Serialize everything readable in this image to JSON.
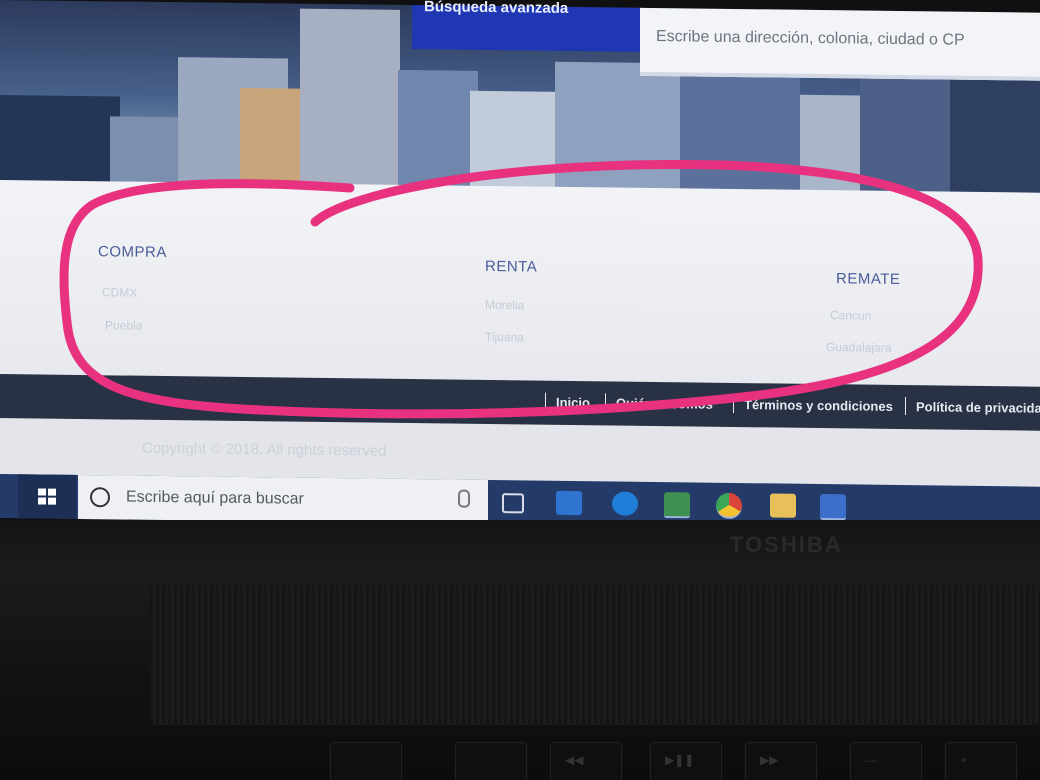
{
  "search": {
    "advanced_label": "Búsqueda avanzada",
    "placeholder": "Escribe una dirección, colonia, ciudad o CP"
  },
  "footer": {
    "columns": [
      {
        "title": "COMPRA",
        "links": [
          "CDMX",
          "Puebla"
        ]
      },
      {
        "title": "RENTA",
        "links": [
          "Morelia",
          "Tijuana"
        ]
      },
      {
        "title": "REMATE",
        "links": [
          "Cancun",
          "Guadalajara"
        ]
      }
    ]
  },
  "nav": {
    "items": [
      "Inicio",
      "Quiénes somos",
      "Términos y condiciones",
      "Política de privacidad"
    ]
  },
  "copyright": "Copyright © 2018. All rights reserved",
  "taskbar": {
    "search_placeholder": "Escribe aquí para buscar",
    "icons": [
      "windows-icon",
      "task-view-icon",
      "outlook-icon",
      "edge-icon",
      "excel-icon",
      "chrome-icon",
      "file-explorer-icon",
      "word-icon"
    ]
  },
  "laptop": {
    "brand": "TOSHIBA"
  },
  "annotation": {
    "color": "#e8327f"
  }
}
